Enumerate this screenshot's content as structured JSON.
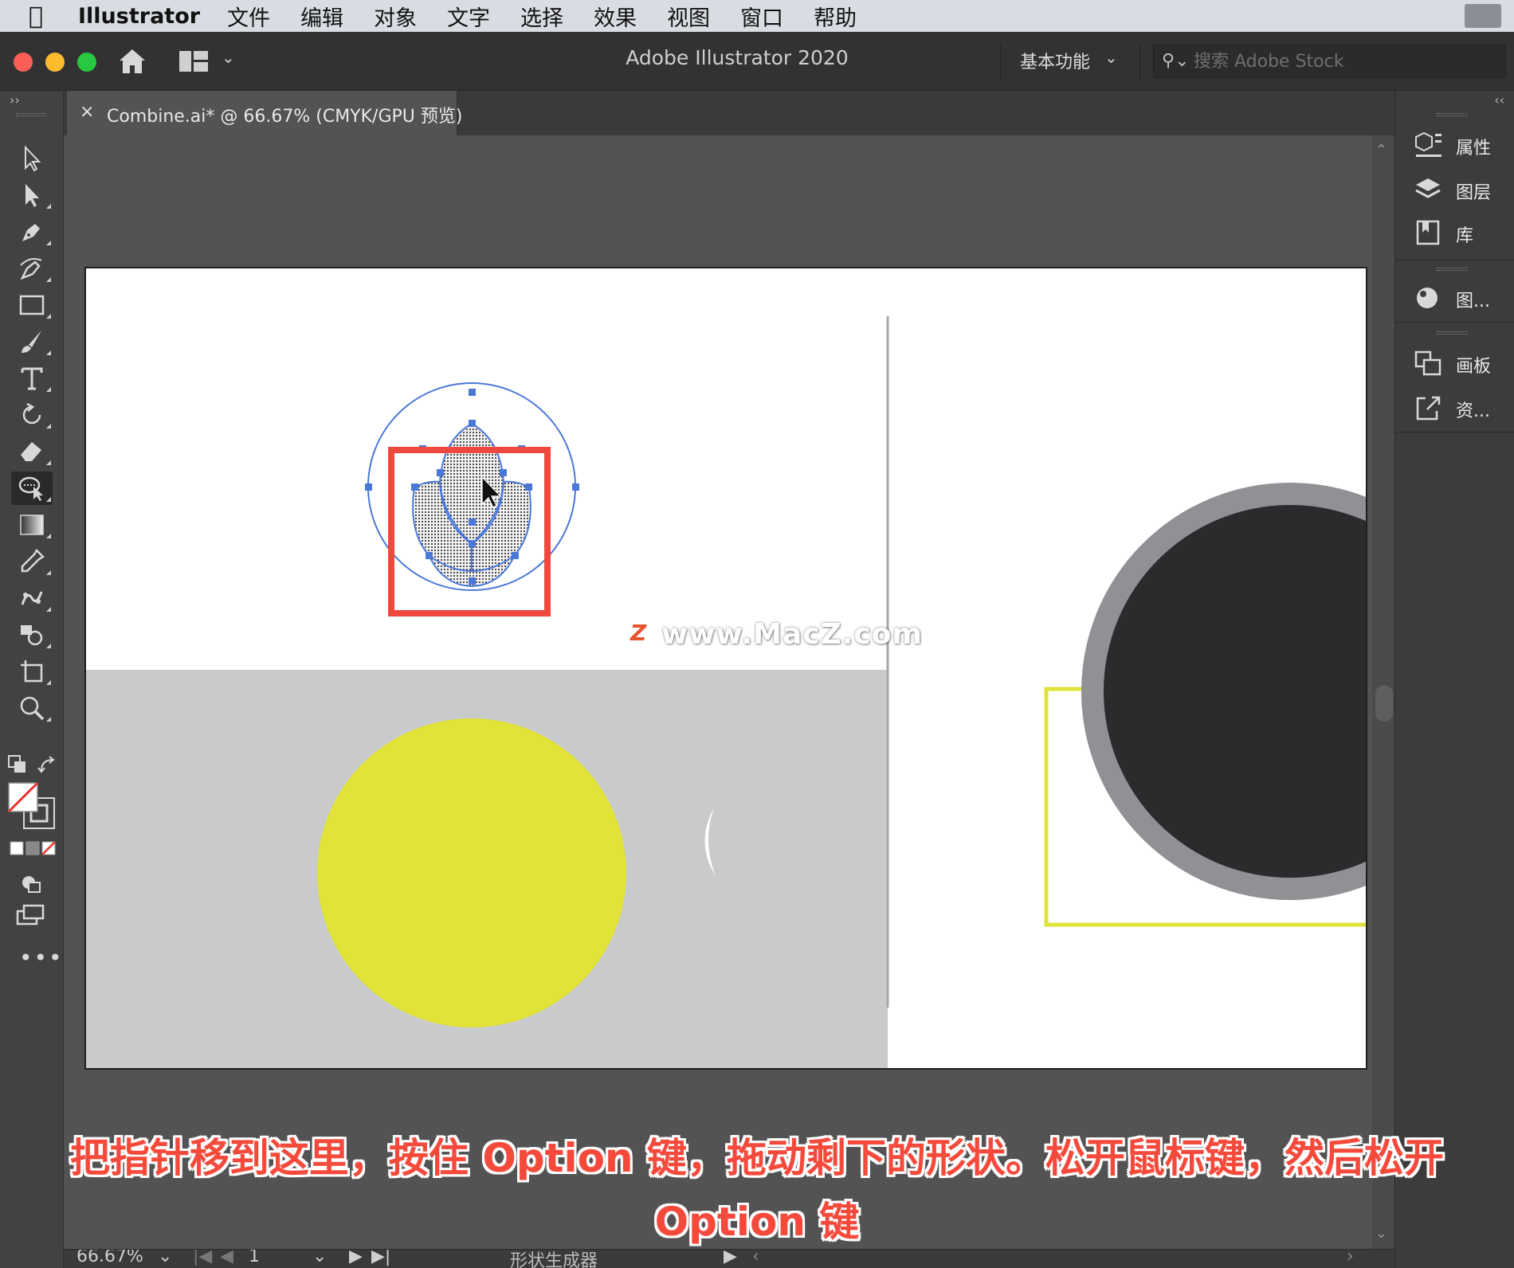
{
  "menubar": {
    "app_name": "Illustrator",
    "items": [
      "文件",
      "编辑",
      "对象",
      "文字",
      "选择",
      "效果",
      "视图",
      "窗口",
      "帮助"
    ]
  },
  "titlebar": {
    "title": "Adobe Illustrator 2020",
    "workspace": "基本功能",
    "stock_search_placeholder": "搜索 Adobe Stock"
  },
  "document_tab": {
    "close": "×",
    "label": "Combine.ai* @ 66.67% (CMYK/GPU 预览)"
  },
  "tools": [
    {
      "name": "selection-tool",
      "icon": "selection-arrow-icon"
    },
    {
      "name": "direct-selection-tool",
      "icon": "direct-selection-icon"
    },
    {
      "name": "pen-tool",
      "icon": "pen-icon"
    },
    {
      "name": "curvature-tool",
      "icon": "curvature-icon"
    },
    {
      "name": "rectangle-tool",
      "icon": "rectangle-icon"
    },
    {
      "name": "paintbrush-tool",
      "icon": "brush-icon"
    },
    {
      "name": "type-tool",
      "icon": "type-icon"
    },
    {
      "name": "rotate-tool",
      "icon": "rotate-icon"
    },
    {
      "name": "eraser-tool",
      "icon": "eraser-icon"
    },
    {
      "name": "shape-builder-tool",
      "icon": "shape-builder-icon",
      "active": true
    },
    {
      "name": "gradient-tool",
      "icon": "gradient-icon"
    },
    {
      "name": "eyedropper-tool",
      "icon": "eyedropper-icon"
    },
    {
      "name": "puppet-warp-tool",
      "icon": "puppet-icon"
    },
    {
      "name": "symbol-sprayer-tool",
      "icon": "symbol-icon"
    },
    {
      "name": "artboard-tool",
      "icon": "artboard-icon"
    },
    {
      "name": "zoom-tool",
      "icon": "zoom-icon"
    }
  ],
  "right_panel": {
    "items": [
      {
        "label": "属性",
        "icon": "properties-icon"
      },
      {
        "label": "图层",
        "icon": "layers-icon"
      },
      {
        "label": "库",
        "icon": "libraries-icon"
      },
      {
        "label": "图...",
        "icon": "graphic-styles-icon"
      },
      {
        "label": "画板",
        "icon": "artboards-icon"
      },
      {
        "label": "资...",
        "icon": "asset-export-icon"
      }
    ]
  },
  "statusbar": {
    "zoom": "66.67%",
    "artboard_number": "1",
    "current_tool": "形状生成器"
  },
  "watermark": {
    "badge": "Z",
    "text": "www.MacZ.com"
  },
  "caption": {
    "line1": "把指针移到这里，按住 Option 键，拖动剩下的形状。松开鼠标键，然后松开",
    "line2": "Option 键"
  },
  "colors": {
    "accent_red": "#f44a3c",
    "yellow": "#e2e338",
    "selection_blue": "#4a78d8",
    "dark_circle": "#2b2b2d",
    "gray_ring": "#8f9194",
    "light_gray_bg": "#c8cacb"
  }
}
